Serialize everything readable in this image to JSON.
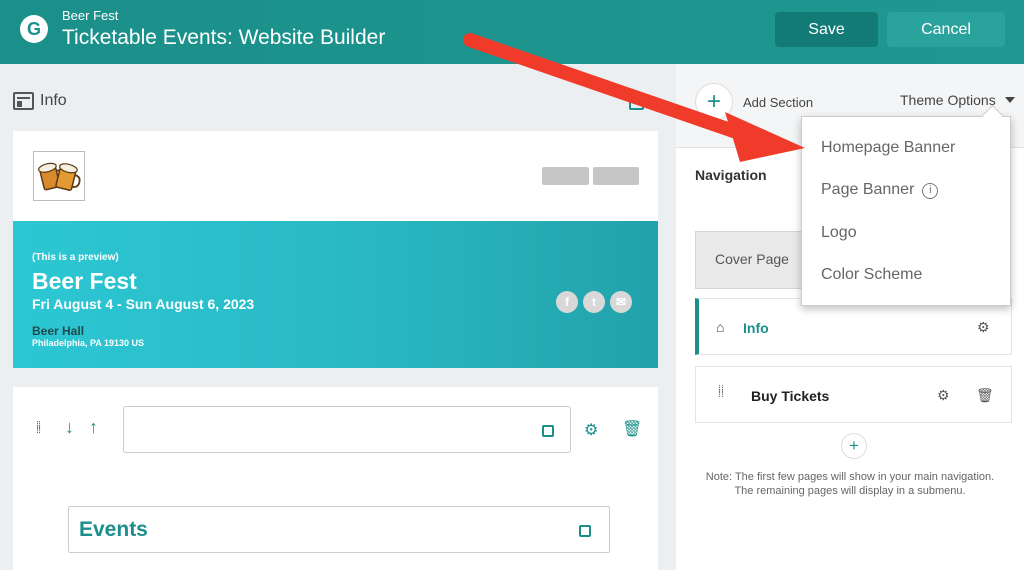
{
  "header": {
    "logo_letter": "G",
    "event_name": "Beer Fest",
    "title": "Ticketable Events: Website Builder",
    "save_label": "Save",
    "cancel_label": "Cancel"
  },
  "editor": {
    "page_label": "Info",
    "banner": {
      "preview_note": "(This is a preview)",
      "title": "Beer Fest",
      "dates": "Fri August 4 - Sun August 6, 2023",
      "venue": "Beer Hall",
      "address": "Philadelphia, PA 19130 US",
      "social": [
        "f",
        "t",
        "✉"
      ]
    },
    "section_label": "Events"
  },
  "sidebar": {
    "add_section_label": "Add Section",
    "theme_options_label": "Theme Options",
    "navigation_heading": "Navigation",
    "cover_page_label": "Cover Page",
    "nav_items": [
      {
        "label": "Info"
      },
      {
        "label": "Buy Tickets"
      }
    ],
    "note_line1": "Note: The first few pages will show in your main navigation.",
    "note_line2": "The remaining pages will display in a submenu."
  },
  "theme_menu": {
    "items": [
      "Homepage Banner",
      "Page Banner",
      "Logo",
      "Color Scheme"
    ]
  },
  "colors": {
    "brand": "#1b8f8a",
    "banner_start": "#2cc7d4",
    "annotation_arrow": "#f03a2a"
  }
}
